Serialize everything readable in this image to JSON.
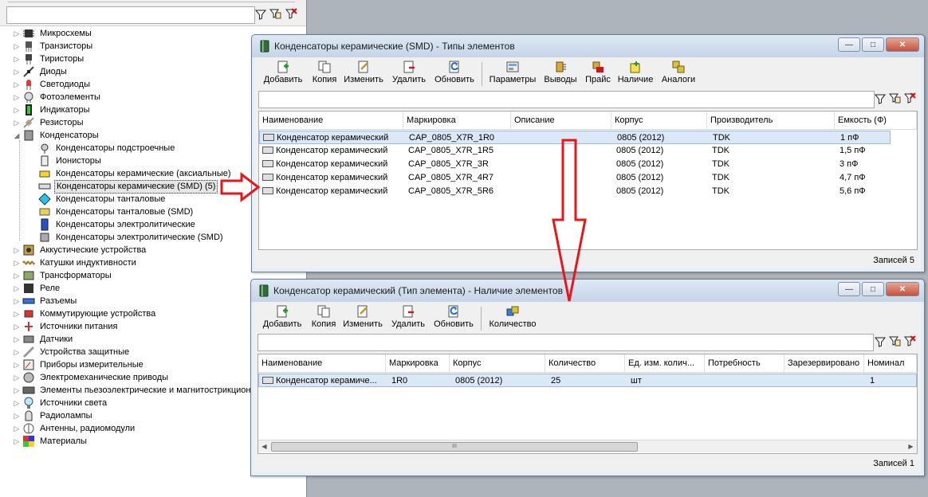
{
  "left_tree": {
    "items": [
      {
        "label": "Микросхемы",
        "icon": "chip-icon",
        "level": 0
      },
      {
        "label": "Транзисторы",
        "icon": "transistor-icon",
        "level": 0
      },
      {
        "label": "Тиристоры",
        "icon": "thyristor-icon",
        "level": 0
      },
      {
        "label": "Диоды",
        "icon": "diode-icon",
        "level": 0
      },
      {
        "label": "Светодиоды",
        "icon": "led-icon",
        "level": 0
      },
      {
        "label": "Фотоэлементы",
        "icon": "photocell-icon",
        "level": 0
      },
      {
        "label": "Индикаторы",
        "icon": "indicator-icon",
        "level": 0
      },
      {
        "label": "Резисторы",
        "icon": "resistor-icon",
        "level": 0
      },
      {
        "label": "Конденсаторы",
        "icon": "capacitor-icon",
        "level": 0,
        "expanded": true
      },
      {
        "label": "Конденсаторы подстроечные",
        "icon": "trimmer-capacitor-icon",
        "level": 1
      },
      {
        "label": "Ионисторы",
        "icon": "ionistor-icon",
        "level": 1
      },
      {
        "label": "Конденсаторы керамические (аксиальные)",
        "icon": "axial-capacitor-icon",
        "level": 1
      },
      {
        "label": "Конденсаторы керамические (SMD) (5)",
        "icon": "smd-capacitor-icon",
        "level": 1,
        "selected": true
      },
      {
        "label": "Конденсаторы танталовые",
        "icon": "tantalum-capacitor-icon",
        "level": 1
      },
      {
        "label": "Конденсаторы танталовые (SMD)",
        "icon": "tantalum-smd-capacitor-icon",
        "level": 1
      },
      {
        "label": "Конденсаторы электролитические",
        "icon": "electrolytic-capacitor-icon",
        "level": 1
      },
      {
        "label": "Конденсаторы электролитические (SMD)",
        "icon": "electrolytic-smd-capacitor-icon",
        "level": 1
      },
      {
        "label": "Аккустические устройства",
        "icon": "speaker-icon",
        "level": 0
      },
      {
        "label": "Катушки индуктивности",
        "icon": "inductor-icon",
        "level": 0
      },
      {
        "label": "Трансформаторы",
        "icon": "transformer-icon",
        "level": 0
      },
      {
        "label": "Реле",
        "icon": "relay-icon",
        "level": 0
      },
      {
        "label": "Разъемы",
        "icon": "connector-icon",
        "level": 0
      },
      {
        "label": "Коммутирующие устройства",
        "icon": "switch-icon",
        "level": 0
      },
      {
        "label": "Источники питания",
        "icon": "power-supply-icon",
        "level": 0
      },
      {
        "label": "Датчики",
        "icon": "sensor-icon",
        "level": 0
      },
      {
        "label": "Устройства защитные",
        "icon": "fuse-icon",
        "level": 0
      },
      {
        "label": "Приборы измерительные",
        "icon": "meter-icon",
        "level": 0
      },
      {
        "label": "Электромеханические приводы",
        "icon": "motor-icon",
        "level": 0
      },
      {
        "label": "Элементы пьезоэлектрические и магнитострикционные",
        "icon": "piezo-icon",
        "level": 0
      },
      {
        "label": "Источники света",
        "icon": "lamp-icon",
        "level": 0
      },
      {
        "label": "Радиолампы",
        "icon": "vacuum-tube-icon",
        "level": 0
      },
      {
        "label": "Антенны, радиомодули",
        "icon": "antenna-icon",
        "level": 0
      },
      {
        "label": "Материалы",
        "icon": "materials-icon",
        "level": 0
      }
    ]
  },
  "window1": {
    "title": "Конденсаторы керамические (SMD) - Типы элементов",
    "toolbar": {
      "add": "Добавить",
      "copy": "Копия",
      "edit": "Изменить",
      "delete": "Удалить",
      "refresh": "Обновить",
      "params": "Параметры",
      "pins": "Выводы",
      "price": "Прайс",
      "availability": "Наличие",
      "analogs": "Аналоги"
    },
    "columns": [
      "Наименование",
      "Маркировка",
      "Описание",
      "Корпус",
      "Производитель",
      "Емкость (Ф)"
    ],
    "rows": [
      [
        "Конденсатор керамический",
        "CAP_0805_X7R_1R0",
        "",
        "0805 (2012)",
        "TDK",
        "1 пФ"
      ],
      [
        "Конденсатор керамический",
        "CAP_0805_X7R_1R5",
        "",
        "0805 (2012)",
        "TDK",
        "1,5 пФ"
      ],
      [
        "Конденсатор керамический",
        "CAP_0805_X7R_3R",
        "",
        "0805 (2012)",
        "TDK",
        "3 пФ"
      ],
      [
        "Конденсатор керамический",
        "CAP_0805_X7R_4R7",
        "",
        "0805 (2012)",
        "TDK",
        "4,7 пФ"
      ],
      [
        "Конденсатор керамический",
        "CAP_0805_X7R_5R6",
        "",
        "0805 (2012)",
        "TDK",
        "5,6 пФ"
      ]
    ],
    "status": "Записей 5"
  },
  "window2": {
    "title": "Конденсатор керамический (Тип элемента) - Наличие элементов",
    "toolbar": {
      "add": "Добавить",
      "copy": "Копия",
      "edit": "Изменить",
      "delete": "Удалить",
      "refresh": "Обновить",
      "quantity": "Количество"
    },
    "columns": [
      "Наименование",
      "Маркировка",
      "Корпус",
      "Количество",
      "Ед. изм. колич...",
      "Потребность",
      "Зарезервировано",
      "Номинал"
    ],
    "rows": [
      [
        "Конденсатор керамиче...",
        "1R0",
        "0805 (2012)",
        "25",
        "шт",
        "",
        "",
        "1"
      ]
    ],
    "scroll_mark": "III",
    "status": "Записей 1"
  },
  "colors": {
    "arrow": "#e8161a",
    "selected_row": "#dbe9f7",
    "title_bar": "#c5d4e7"
  }
}
